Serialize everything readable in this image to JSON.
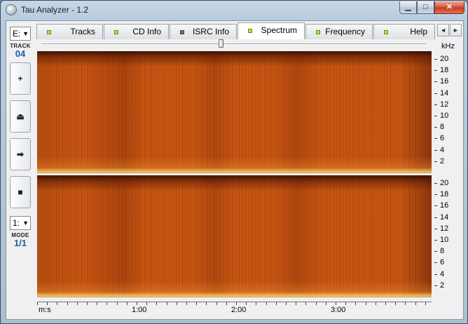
{
  "window": {
    "title": "Tau Analyzer - 1.2",
    "min_label": "▁",
    "max_label": "□",
    "close_label": "✕"
  },
  "left_panel": {
    "drive_select": "E:",
    "track_caption": "TRACK",
    "track_value": "04",
    "buttons": [
      {
        "name": "plus",
        "glyph": "+"
      },
      {
        "name": "eject",
        "glyph": "⏏"
      },
      {
        "name": "play",
        "glyph": "➡"
      },
      {
        "name": "stop",
        "glyph": "■"
      }
    ],
    "mode_select": "1:",
    "mode_caption": "MODE",
    "mode_value": "1/1"
  },
  "tabs": [
    {
      "label": "Tracks",
      "led": "green"
    },
    {
      "label": "CD Info",
      "led": "green"
    },
    {
      "label": "ISRC Info",
      "led": "grey"
    },
    {
      "label": "Spectrum",
      "led": "green",
      "active": true
    },
    {
      "label": "Frequency",
      "led": "green"
    },
    {
      "label": "Help",
      "led": "green"
    }
  ],
  "tab_scroll": {
    "left": "◄",
    "right": "►"
  },
  "slider": {
    "position": 0.46
  },
  "freq_axis": {
    "unit": "kHz",
    "labels": [
      "20",
      "18",
      "16",
      "14",
      "12",
      "10",
      "8",
      "6",
      "4",
      "2"
    ]
  },
  "time_axis": {
    "unit_label": "m:s",
    "labels": [
      "1:00",
      "2:00",
      "3:00"
    ]
  },
  "colors": {
    "spectrum_base": "#c45412",
    "accent_blue": "#1d5ea8",
    "led_green": "#b4e23a"
  }
}
